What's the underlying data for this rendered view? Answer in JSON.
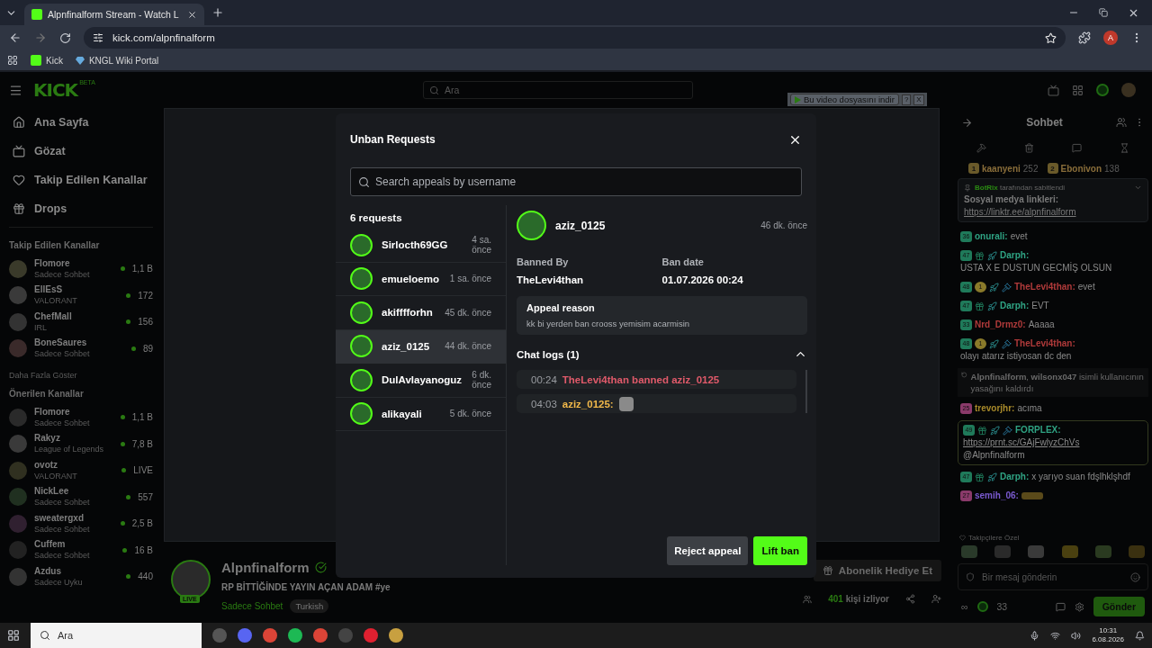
{
  "browser": {
    "tab_title": "Alpnfinalform Stream - Watch L",
    "url": "kick.com/alpnfinalform",
    "bookmarks": [
      "Kick",
      "KNGL Wiki Portal"
    ],
    "profile_initial": "A"
  },
  "header": {
    "logo": "KICK",
    "logo_tag": "BETA",
    "search_placeholder": "Ara"
  },
  "download_bar": {
    "label": "Bu video dosyasını indir",
    "help": "?",
    "close": "X"
  },
  "sidebar": {
    "nav": [
      "Ana Sayfa",
      "Gözat",
      "Takip Edilen Kanallar",
      "Drops"
    ],
    "followed_title": "Takip Edilen Kanallar",
    "followed": [
      {
        "name": "Flomore",
        "category": "Sadece Sohbet",
        "viewers": "1,1 B"
      },
      {
        "name": "EllEsS",
        "category": "VALORANT",
        "viewers": "172"
      },
      {
        "name": "ChefMall",
        "category": "IRL",
        "viewers": "156"
      },
      {
        "name": "BoneSaures",
        "category": "Sadece Sohbet",
        "viewers": "89"
      }
    ],
    "show_more": "Daha Fazla Göster",
    "recommended_title": "Önerilen Kanallar",
    "recommended": [
      {
        "name": "Flomore",
        "category": "Sadece Sohbet",
        "viewers": "1,1 B"
      },
      {
        "name": "Rakyz",
        "category": "League of Legends",
        "viewers": "7,8 B"
      },
      {
        "name": "ovotz",
        "category": "VALORANT",
        "viewers": "LIVE"
      },
      {
        "name": "NickLee",
        "category": "Sadece Sohbet",
        "viewers": "557"
      },
      {
        "name": "sweatergxd",
        "category": "Sadece Sohbet",
        "viewers": "2,5 B"
      },
      {
        "name": "Cuffem",
        "category": "Sadece Sohbet",
        "viewers": "16 B"
      },
      {
        "name": "Azdus",
        "category": "Sadece Uyku",
        "viewers": "440"
      }
    ]
  },
  "stream_info": {
    "channel": "Alpnfinalform",
    "live_badge": "LIVE",
    "title": "RP BİTTİĞİNDE YAYIN AÇAN ADAM #ye",
    "category": "Sadece Sohbet",
    "tags": [
      "Turkish"
    ],
    "gift_button": "Abonelik Hediye Et",
    "viewers": "401",
    "viewers_label": "kişi izliyor"
  },
  "chat": {
    "title": "Sohbet",
    "leaderboard": [
      {
        "rank": "1",
        "name": "kaanyeni",
        "points": "252"
      },
      {
        "rank": "2",
        "name": "Ebonivon",
        "points": "138"
      }
    ],
    "pinned": {
      "author": "BotRix",
      "suffix": "tarafından sabitlendi",
      "text": "Sosyal medya linkleri:",
      "link": "https://linktr.ee/alpnfinalform"
    },
    "messages": [
      {
        "kind": "message",
        "badges": [
          {
            "kind": "sub",
            "label": "36"
          }
        ],
        "user": "onurali:",
        "color": "#2fa383",
        "text": "evet",
        "highlighted": false
      },
      {
        "kind": "message",
        "badges": [
          {
            "kind": "sub",
            "label": "47"
          },
          {
            "kind": "gift"
          },
          {
            "kind": "vip"
          }
        ],
        "user": "Darph:",
        "color": "#2fa383",
        "text": "USTA X E DUSTUN GECMİŞ OLSUN",
        "highlighted": false
      },
      {
        "kind": "message",
        "badges": [
          {
            "kind": "sub",
            "label": "48"
          },
          {
            "kind": "og",
            "label": "1"
          },
          {
            "kind": "vip"
          },
          {
            "kind": "mod"
          }
        ],
        "user": "TheLevi4than:",
        "color": "#b03a3a",
        "text": "evet",
        "highlighted": false
      },
      {
        "kind": "message",
        "badges": [
          {
            "kind": "sub",
            "label": "47"
          },
          {
            "kind": "gift"
          },
          {
            "kind": "vip"
          }
        ],
        "user": "Darph:",
        "color": "#2fa383",
        "text": "EVT",
        "highlighted": false
      },
      {
        "kind": "message",
        "badges": [
          {
            "kind": "sub",
            "label": "33"
          }
        ],
        "user": "Nrd_Drmz0:",
        "color": "#b03a3a",
        "text": "Aaaaa",
        "highlighted": false
      },
      {
        "kind": "message",
        "badges": [
          {
            "kind": "sub",
            "label": "48"
          },
          {
            "kind": "og",
            "label": "1"
          },
          {
            "kind": "vip"
          },
          {
            "kind": "mod"
          }
        ],
        "user": "TheLevi4than:",
        "color": "#b03a3a",
        "text": "olayı atarız istiyosan dc den",
        "highlighted": false
      },
      {
        "kind": "system",
        "text": "**Alpnfinalform**, **wilsonx047** isimli kullanıcının yasağını kaldırdı"
      },
      {
        "kind": "message",
        "badges": [
          {
            "kind": "pink",
            "label": "25"
          }
        ],
        "user": "trevorjhr:",
        "color": "#a88a2a",
        "text": "acıma",
        "highlighted": false
      },
      {
        "kind": "message",
        "badges": [
          {
            "kind": "sub",
            "label": "49"
          },
          {
            "kind": "gift"
          },
          {
            "kind": "vip"
          },
          {
            "kind": "mod"
          }
        ],
        "user": "FORPLEX:",
        "color": "#2fa383",
        "link": "https://prnt.sc/GAjFwlyzChVs",
        "text": "@Alpnfinalform",
        "highlighted": true
      },
      {
        "kind": "message",
        "badges": [
          {
            "kind": "sub",
            "label": "47"
          },
          {
            "kind": "gift"
          },
          {
            "kind": "vip"
          }
        ],
        "user": "Darph:",
        "color": "#2fa383",
        "text": "x yarıyo suan fdşlhklşhdf",
        "highlighted": false
      },
      {
        "kind": "emote",
        "badges": [
          {
            "kind": "pink",
            "label": "27"
          }
        ],
        "user": "semih_06:",
        "color": "#7a5ad0",
        "highlighted": false
      }
    ],
    "followers_only_label": "Takipçilere Özel",
    "input_placeholder": "Bir mesaj gönderin",
    "points_label": "∞",
    "points": "33",
    "send": "Gönder"
  },
  "modal": {
    "title": "Unban Requests",
    "search_placeholder": "Search appeals by username",
    "count_label": "6 requests",
    "requests": [
      {
        "name": "Sirlocth69GG",
        "time": "4 sa. önce",
        "selected": false
      },
      {
        "name": "emueloemo",
        "time": "1 sa. önce",
        "selected": false
      },
      {
        "name": "akifffforhn",
        "time": "45 dk. önce",
        "selected": false
      },
      {
        "name": "aziz_0125",
        "time": "44 dk. önce",
        "selected": true
      },
      {
        "name": "DulAvlayanoguz",
        "time": "6 dk. önce",
        "selected": false
      },
      {
        "name": "alikayali",
        "time": "5 dk. önce",
        "selected": false
      }
    ],
    "detail": {
      "name": "aziz_0125",
      "time": "46 dk. önce",
      "banned_by_label": "Banned By",
      "banned_by": "TheLevi4than",
      "ban_date_label": "Ban date",
      "ban_date": "01.07.2026 00:24",
      "reason_label": "Appeal reason",
      "reason": "kk bi yerden ban crooss yemisim acarmisin",
      "logs_title": "Chat logs (1)",
      "logs_expanded": true,
      "logs": [
        {
          "kind": "ban",
          "time": "00:24",
          "text": "TheLevi4than banned aziz_0125"
        },
        {
          "kind": "message",
          "time": "04:03",
          "user": "aziz_0125:"
        }
      ]
    },
    "reject": "Reject appeal",
    "lift": "Lift ban"
  },
  "taskbar": {
    "search_placeholder": "Ara",
    "time": "10:31",
    "date": "6.08.2026"
  }
}
